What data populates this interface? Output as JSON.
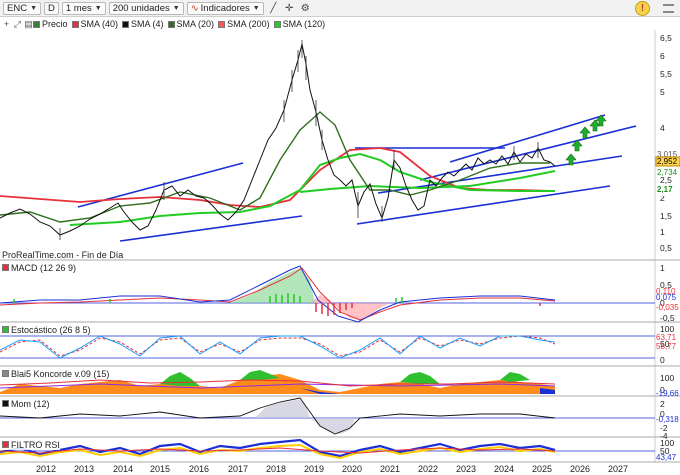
{
  "toolbar": {
    "symbol": "ENC",
    "period_letter": "D",
    "timeframe": "1 mes",
    "units": "200 unidades",
    "indicators": "Indicadores"
  },
  "legend": {
    "items": [
      {
        "label": "Precio",
        "color": "#3a7d3a"
      },
      {
        "label": "SMA (40)",
        "color": "#e8303a"
      },
      {
        "label": "SMA (4)",
        "color": "#111111"
      },
      {
        "label": "SMA (20)",
        "color": "#2f6f1f"
      },
      {
        "label": "SMA (200)",
        "color": "#ff5555"
      },
      {
        "label": "SMA (120)",
        "color": "#22cc22"
      }
    ]
  },
  "attribution": "ProRealTime.com - Fin de Día",
  "price_axis": {
    "ticks": [
      "6,5",
      "6",
      "5,5",
      "5",
      "4",
      "3",
      "2,5",
      "2",
      "1,5",
      "1",
      "0,5"
    ],
    "tags": [
      {
        "text": "3,015",
        "color": "#555555",
        "fill": "#ffffff"
      },
      {
        "text": "2,952",
        "color": "#000000",
        "fill": "#ffd34d"
      },
      {
        "text": "2,734",
        "color": "#1d8f1d",
        "fill": "#ffffff"
      },
      {
        "text": "2,17",
        "color": "#1d8f1d",
        "fill": "#ffffff"
      }
    ]
  },
  "panels": {
    "macd": {
      "label": "MACD (12 26 9)",
      "ticks": [
        "1",
        "0,5",
        "0",
        "-0,5"
      ],
      "tags": [
        "0,110",
        "0,075",
        "-0,035"
      ]
    },
    "stoch": {
      "label": "Estocástico (26 8 5)",
      "ticks": [
        "100",
        "50",
        "0"
      ],
      "tags": [
        "63,71",
        "58,77"
      ]
    },
    "koncorde": {
      "label": "Blai5 Koncorde v.09 (15)",
      "ticks": [
        "100",
        "0"
      ],
      "tags": [
        "-19,66"
      ]
    },
    "mom": {
      "label": "Mom (12)",
      "ticks": [
        "2",
        "0",
        "-2",
        "-4"
      ],
      "tags": [
        "-0,318"
      ]
    },
    "filtro": {
      "label": "FILTRO RSI",
      "ticks": [
        "100",
        "50"
      ],
      "tags": [
        "43,47"
      ]
    }
  },
  "years": [
    "2012",
    "2013",
    "2014",
    "2015",
    "2016",
    "2017",
    "2018",
    "2019",
    "2020",
    "2021",
    "2022",
    "2023",
    "2024",
    "2025",
    "2026",
    "2027"
  ]
}
